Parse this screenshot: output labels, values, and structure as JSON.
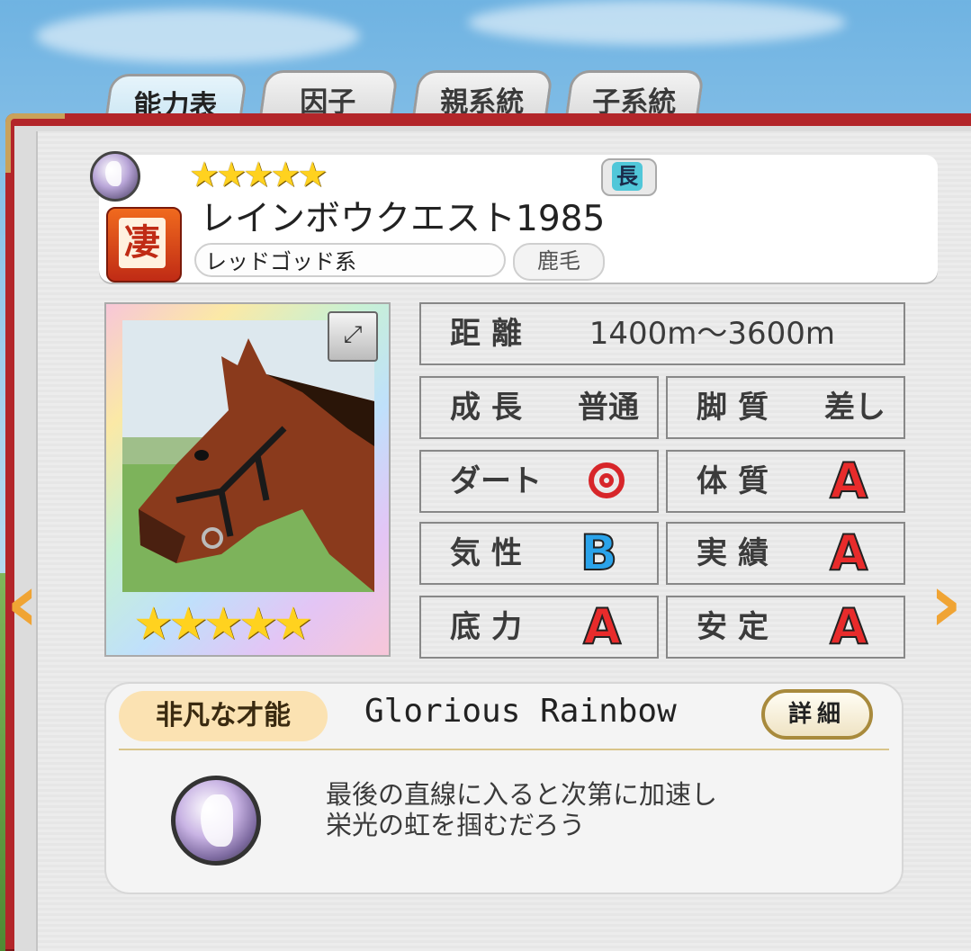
{
  "tabs": [
    {
      "label": "能力表",
      "active": true
    },
    {
      "label": "因子",
      "active": false
    },
    {
      "label": "親系統",
      "active": false
    },
    {
      "label": "子系統",
      "active": false
    }
  ],
  "header": {
    "rarity_stars": "★★★★★",
    "distance_badge": "長",
    "type_icon": "凄",
    "horse_name": "レインボウクエスト1985",
    "lineage": "レッドゴッド系",
    "coat": "鹿毛"
  },
  "portrait": {
    "stars": "★★★★★",
    "expand_icon": "expand-icon"
  },
  "stats": {
    "distance": {
      "label": "距離",
      "value": "1400m〜3600m"
    },
    "growth": {
      "label": "成長",
      "value": "普通"
    },
    "running_style": {
      "label": "脚質",
      "value": "差し"
    },
    "dirt": {
      "label": "ダート",
      "value": "double-circle"
    },
    "constitution": {
      "label": "体質",
      "value": "A"
    },
    "temperament": {
      "label": "気性",
      "value": "B"
    },
    "record": {
      "label": "実績",
      "value": "A"
    },
    "stamina": {
      "label": "底力",
      "value": "A"
    },
    "stability": {
      "label": "安定",
      "value": "A"
    }
  },
  "talent": {
    "badge": "非凡な才能",
    "name": "Glorious Rainbow",
    "detail_button": "詳細",
    "description_line1": "最後の直線に入ると次第に加速し",
    "description_line2": "栄光の虹を掴むだろう"
  },
  "nav": {
    "prev": "‹",
    "next": "›"
  },
  "colors": {
    "book_red": "#b3262a",
    "grade_A": "#e82b2b",
    "grade_B": "#2aa3ea",
    "arrow": "#f0a434"
  }
}
